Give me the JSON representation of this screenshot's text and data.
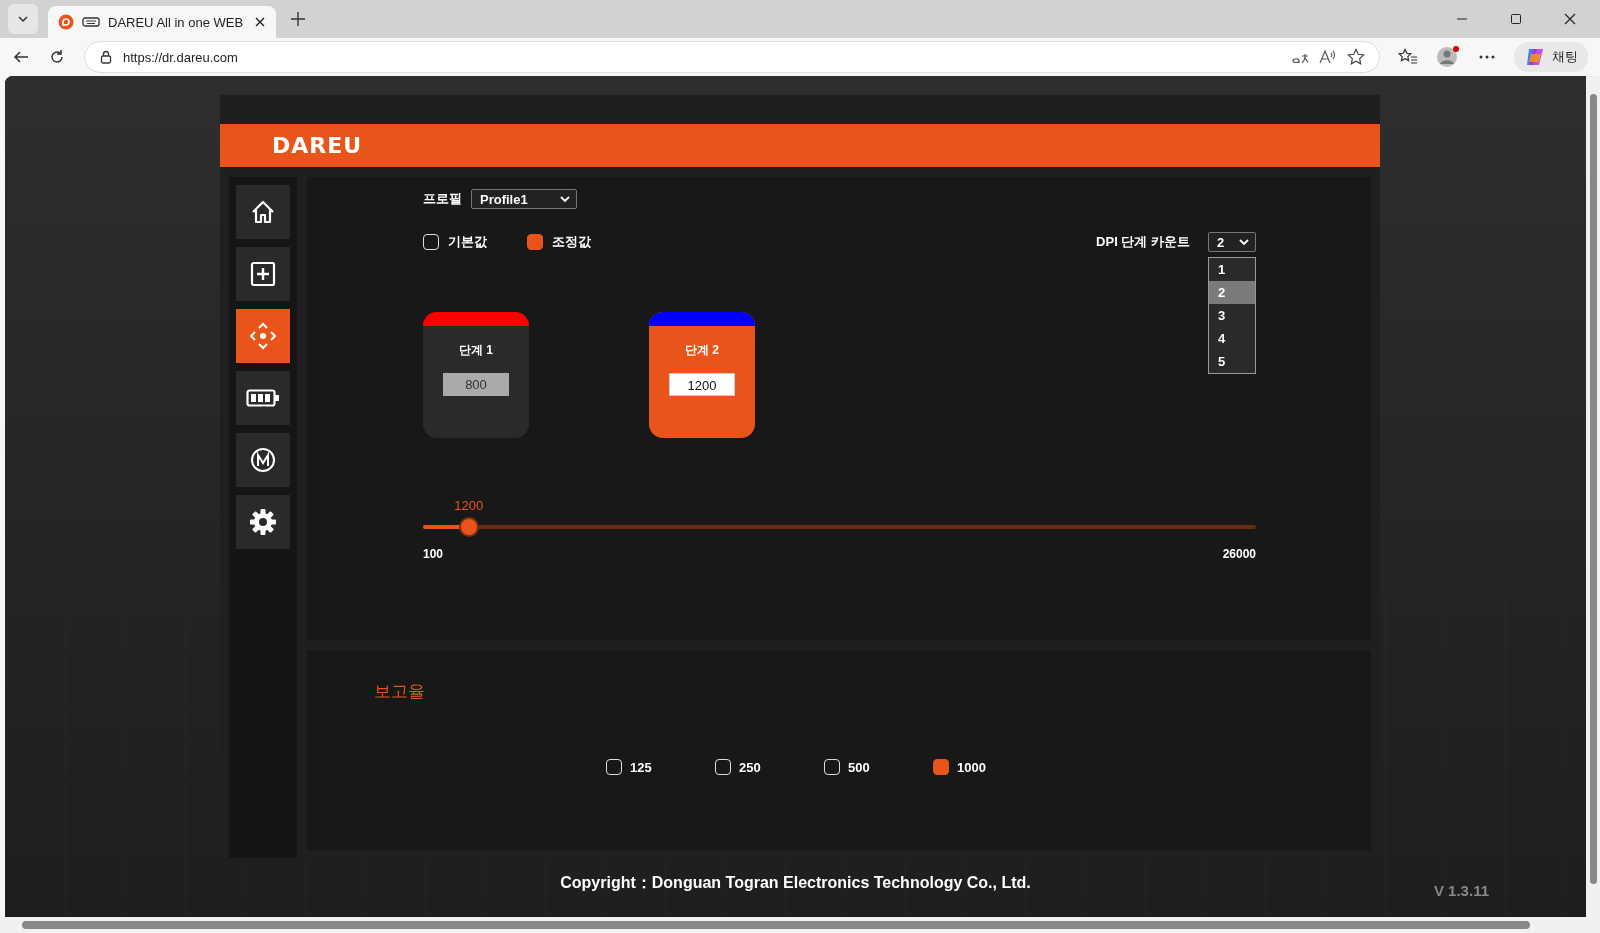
{
  "browser": {
    "tab_title": "DAREU All in one WEB",
    "url": "https://dr.dareu.com",
    "chat_label": "채팅"
  },
  "app": {
    "logo": "DAREU",
    "nav": [
      {
        "kind": "home",
        "selected": false
      },
      {
        "kind": "plus",
        "selected": false
      },
      {
        "kind": "move",
        "selected": true
      },
      {
        "kind": "battery",
        "selected": false
      },
      {
        "kind": "macro",
        "selected": false
      },
      {
        "kind": "settings",
        "selected": false
      }
    ],
    "profile": {
      "label": "프로필",
      "value": "Profile1"
    },
    "modes": [
      {
        "label": "기본값",
        "checked": false
      },
      {
        "label": "조정값",
        "checked": true
      }
    ],
    "dpi_count": {
      "label": "DPI 단계 카운트",
      "value": "2",
      "options": [
        {
          "label": "1",
          "selected": false
        },
        {
          "label": "2",
          "selected": true
        },
        {
          "label": "3",
          "selected": false
        },
        {
          "label": "4",
          "selected": false
        },
        {
          "label": "5",
          "selected": false
        }
      ]
    },
    "stages": [
      {
        "label": "단계 1",
        "value": "800",
        "color": "#ff0000",
        "selected": false
      },
      {
        "label": "단계 2",
        "value": "1200",
        "color": "#0000ff",
        "selected": true
      }
    ],
    "slider": {
      "value_label": "1200",
      "level": 0.055,
      "min_label": "100",
      "max_label": "26000"
    },
    "report_rate": {
      "title": "보고율",
      "options": [
        {
          "label": "125",
          "checked": false
        },
        {
          "label": "250",
          "checked": false
        },
        {
          "label": "500",
          "checked": false
        },
        {
          "label": "1000",
          "checked": true
        }
      ]
    },
    "footer": {
      "copyright": "Copyright：Donguan Togran Electronics Technology Co., Ltd.",
      "version": "V 1.3.11"
    }
  }
}
